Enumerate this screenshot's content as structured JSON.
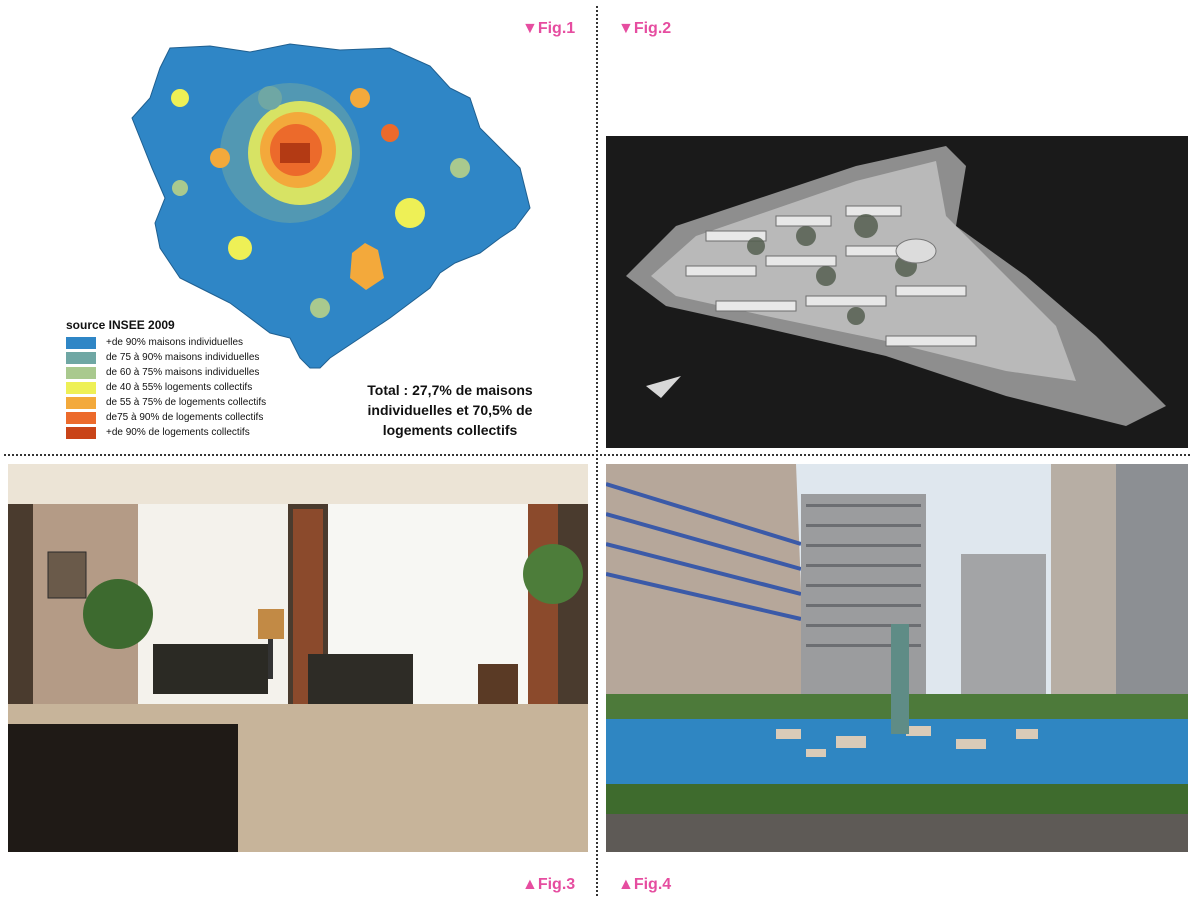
{
  "figures": {
    "fig1": "▼Fig.1",
    "fig2": "▼Fig.2",
    "fig3": "▲Fig.3",
    "fig4": "▲Fig.4"
  },
  "map": {
    "source": "source INSEE 2009",
    "legend": [
      {
        "label": "+de 90% maisons individuelles",
        "color": "#2f86c6"
      },
      {
        "label": "de 75 à 90% maisons individuelles",
        "color": "#6fa7a4"
      },
      {
        "label": "de 60 à 75% maisons individuelles",
        "color": "#a9c98e"
      },
      {
        "label": "de 40 à 55% logements collectifs",
        "color": "#eef056"
      },
      {
        "label": "de 55 à 75% de logements collectifs",
        "color": "#f3a93b"
      },
      {
        "label": "de75 à 90% de logements collectifs",
        "color": "#ec6a2b"
      },
      {
        "label": "+de 90% de logements collectifs",
        "color": "#c94418"
      }
    ],
    "total_line1": "Total : 27,7% de maisons",
    "total_line2": "individuelles et 70,5% de",
    "total_line3": "logements collectifs"
  }
}
